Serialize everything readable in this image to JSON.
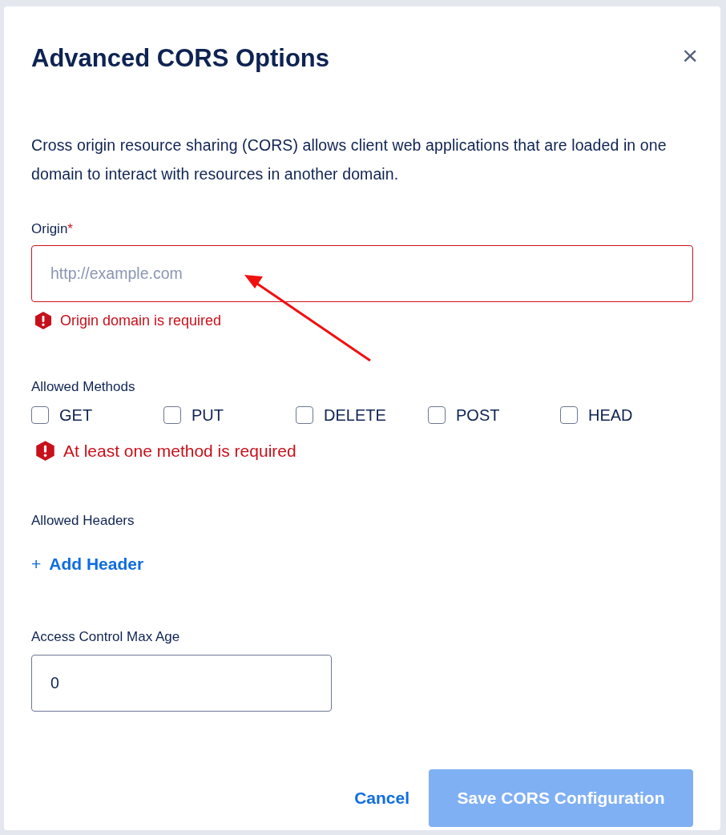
{
  "dialog": {
    "title": "Advanced CORS Options",
    "close": "×"
  },
  "description": "Cross origin resource sharing (CORS) allows client web applications that are loaded in one domain to interact with resources in another domain.",
  "origin": {
    "label": "Origin",
    "required_mark": "*",
    "placeholder": "http://example.com",
    "error": "Origin domain is required"
  },
  "methods": {
    "label": "Allowed Methods",
    "items": [
      {
        "label": "GET",
        "checked": false
      },
      {
        "label": "PUT",
        "checked": false
      },
      {
        "label": "DELETE",
        "checked": false
      },
      {
        "label": "POST",
        "checked": false
      },
      {
        "label": "HEAD",
        "checked": false
      }
    ],
    "error": "At least one method is required"
  },
  "headers": {
    "label": "Allowed Headers",
    "add": "+",
    "add_label": "Add Header"
  },
  "max_age": {
    "label": "Access Control Max Age",
    "value": "0"
  },
  "buttons": {
    "cancel": "Cancel",
    "save": {
      "label": "Save CORS Configuration",
      "disabled": true
    }
  }
}
